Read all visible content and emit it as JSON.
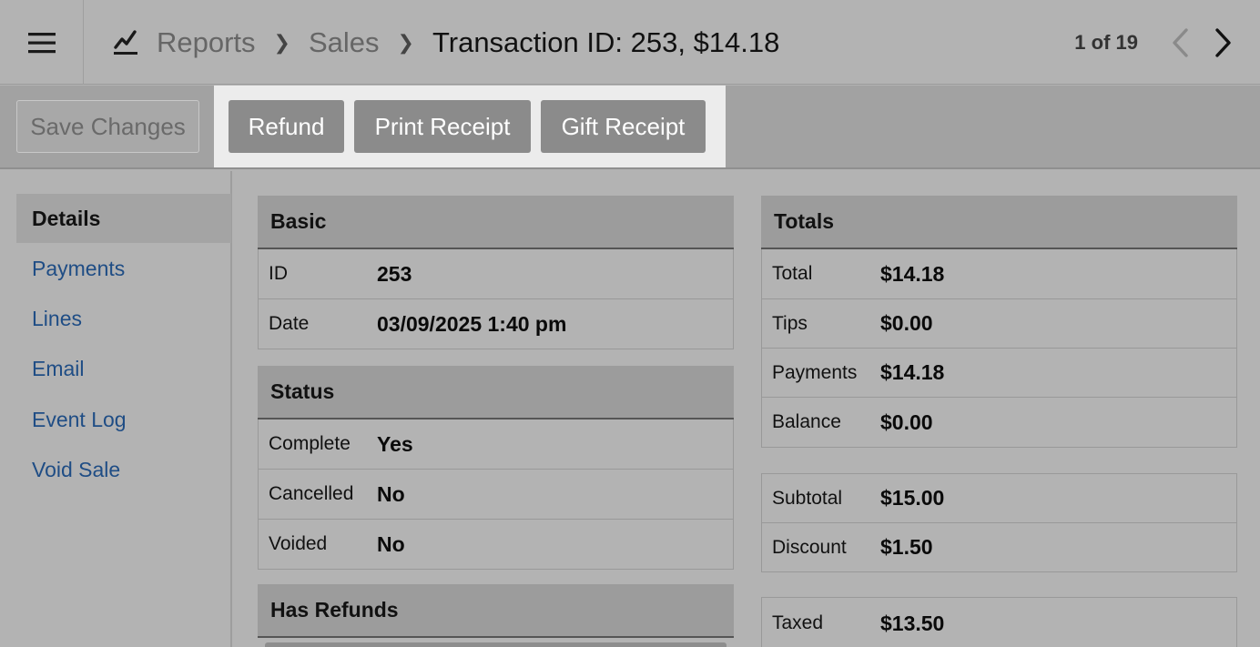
{
  "header": {
    "breadcrumb": [
      "Reports",
      "Sales"
    ],
    "title": "Transaction ID: 253, $14.18",
    "pager": "1 of 19"
  },
  "toolbar": {
    "save_label": "Save Changes",
    "refund_label": "Refund",
    "print_label": "Print Receipt",
    "gift_label": "Gift Receipt"
  },
  "sidebar": {
    "items": [
      {
        "label": "Details"
      },
      {
        "label": "Payments"
      },
      {
        "label": "Lines"
      },
      {
        "label": "Email"
      },
      {
        "label": "Event Log"
      },
      {
        "label": "Void Sale"
      }
    ]
  },
  "basic": {
    "title": "Basic",
    "rows": [
      {
        "label": "ID",
        "value": "253"
      },
      {
        "label": "Date",
        "value": "03/09/2025 1:40 pm"
      }
    ]
  },
  "status": {
    "title": "Status",
    "rows": [
      {
        "label": "Complete",
        "value": "Yes"
      },
      {
        "label": "Cancelled",
        "value": "No"
      },
      {
        "label": "Voided",
        "value": "No"
      }
    ]
  },
  "refunds": {
    "title": "Has Refunds"
  },
  "totals": {
    "title": "Totals",
    "rows": [
      {
        "label": "Total",
        "value": "$14.18"
      },
      {
        "label": "Tips",
        "value": "$0.00"
      },
      {
        "label": "Payments",
        "value": "$14.18"
      },
      {
        "label": "Balance",
        "value": "$0.00"
      }
    ],
    "rows2": [
      {
        "label": "Subtotal",
        "value": "$15.00"
      },
      {
        "label": "Discount",
        "value": "$1.50"
      }
    ],
    "rows3": [
      {
        "label": "Taxed",
        "value": "$13.50"
      }
    ]
  }
}
